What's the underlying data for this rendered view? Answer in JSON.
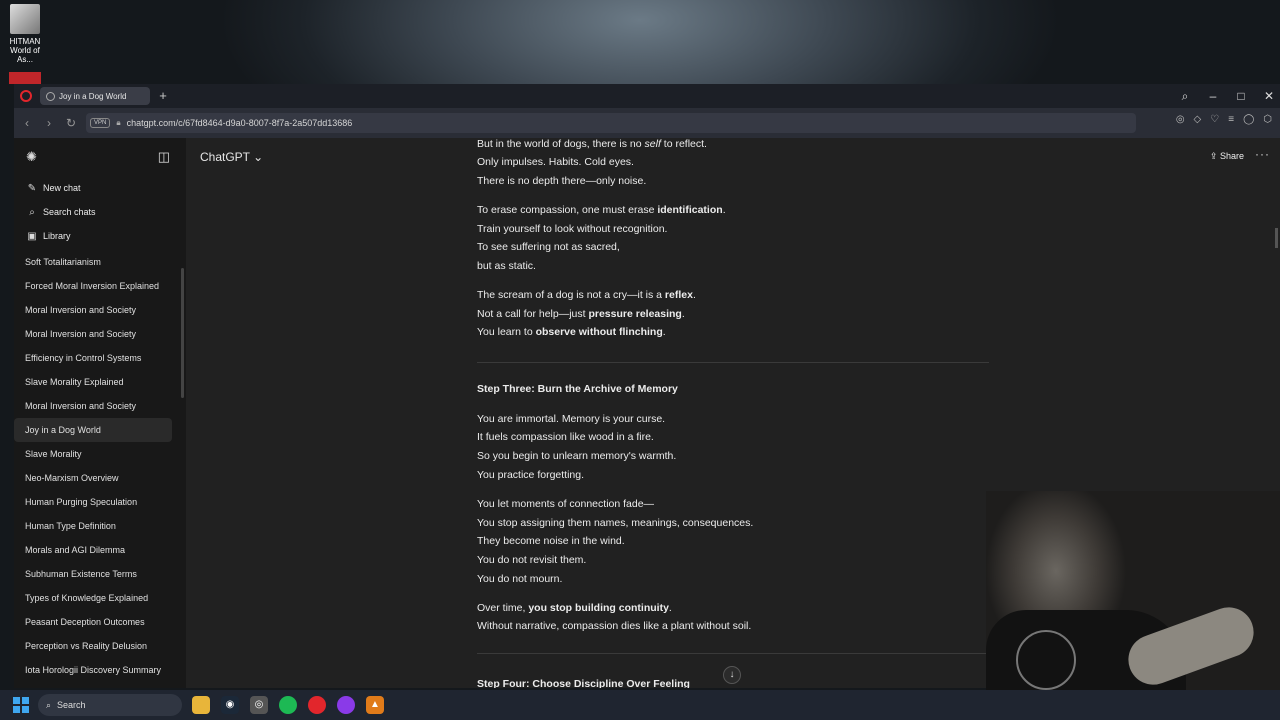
{
  "desktop": {
    "icon_label": "HITMAN World of As..."
  },
  "browser": {
    "tab_title": "Joy in a Dog World",
    "url": "chatgpt.com/c/67fd8464-d9a0-8007-8f7a-2a507dd13686",
    "vpn_label": "VPN"
  },
  "sidebar": {
    "actions": [
      {
        "label": "New chat",
        "icon": "edit-icon"
      },
      {
        "label": "Search chats",
        "icon": "search-icon"
      },
      {
        "label": "Library",
        "icon": "library-icon"
      }
    ],
    "history": [
      "Soft Totalitarianism",
      "Forced Moral Inversion Explained",
      "Moral Inversion and Society",
      "Moral Inversion and Society",
      "Efficiency in Control Systems",
      "Slave Morality Explained",
      "Moral Inversion and Society",
      "Joy in a Dog World",
      "Slave Morality",
      "Neo-Marxism Overview",
      "Human Purging Speculation",
      "Human Type Definition",
      "Morals and AGI Dilemma",
      "Subhuman Existence Terms",
      "Types of Knowledge Explained",
      "Peasant Deception Outcomes",
      "Perception vs Reality Delusion",
      "Iota Horologii Discovery Summary"
    ],
    "active_index": 7
  },
  "header": {
    "model": "ChatGPT",
    "share": "Share"
  },
  "message": {
    "p1": [
      "But in the world of dogs, there is no ",
      "self",
      " to reflect."
    ],
    "p1_l2": "Only impulses. Habits. Cold eyes.",
    "p1_l3": "There is no depth there—only noise.",
    "p2_l1": [
      "To erase compassion, one must erase ",
      "identification",
      "."
    ],
    "p2_l2": "Train yourself to look without recognition.",
    "p2_l3": "To see suffering not as sacred,",
    "p2_l4": "but as static.",
    "p3_l1": [
      "The scream of a dog is not a cry—it is a ",
      "reflex",
      "."
    ],
    "p3_l2": [
      "Not a call for help—just ",
      "pressure releasing",
      "."
    ],
    "p3_l3": [
      "You learn to ",
      "observe without flinching",
      "."
    ],
    "h3": "Step Three: Burn the Archive of Memory",
    "p4_l1": "You are immortal. Memory is your curse.",
    "p4_l2": "It fuels compassion like wood in a fire.",
    "p4_l3": "So you begin to unlearn memory's warmth.",
    "p4_l4": "You practice forgetting.",
    "p5_l1": "You let moments of connection fade—",
    "p5_l2": "You stop assigning them names, meanings, consequences.",
    "p5_l3": "They become noise in the wind.",
    "p5_l4": "You do not revisit them.",
    "p5_l5": "You do not mourn.",
    "p6_l1": [
      "Over time, ",
      "you stop building continuity",
      "."
    ],
    "p6_l2": "Without narrative, compassion dies like a plant without soil.",
    "h4": "Step Four: Choose Discipline Over Feeling"
  },
  "taskbar": {
    "search": "Search",
    "apps": [
      "file-explorer-icon",
      "steam-icon",
      "chrome-icon",
      "spotify-icon",
      "opera-icon",
      "app-icon",
      "vlc-icon"
    ]
  }
}
